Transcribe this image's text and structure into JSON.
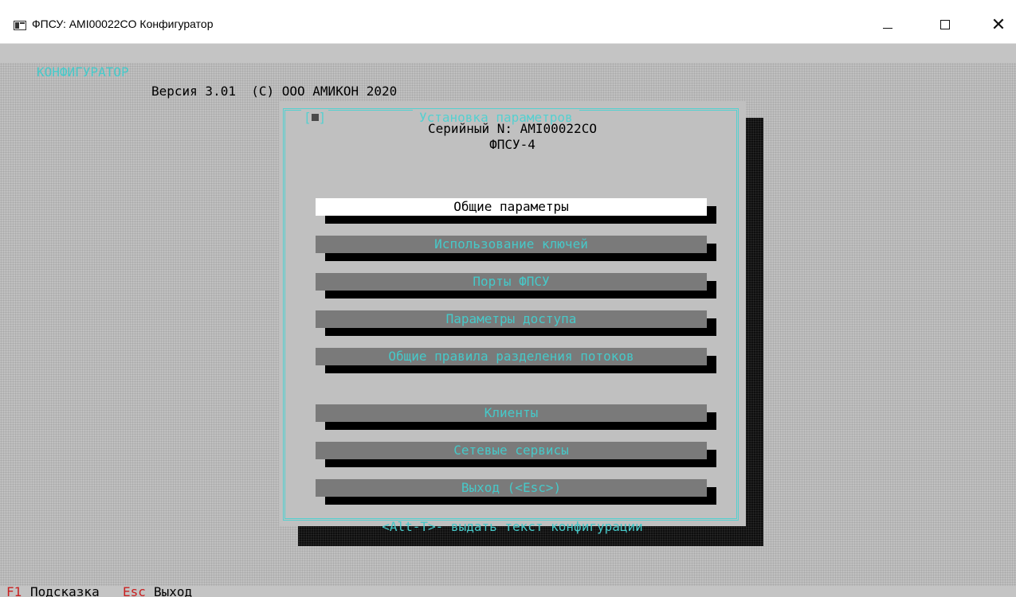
{
  "window": {
    "title": "ФПСУ: AMI00022CO Конфигуратор",
    "minimize_label": "—",
    "maximize_label": "",
    "close_label": "✕"
  },
  "header": {
    "brand": "КОНФИГУРАТОР",
    "version": "Версия 3.01  (C) ООО АМИКОН 2020"
  },
  "dialog": {
    "close_box": "[",
    "close_box_end": "]",
    "title": "Установка параметров",
    "serial": "Серийный N: AMI00022CO",
    "model": "ФПСУ-4",
    "menu": [
      {
        "label": "Общие параметры",
        "selected": true
      },
      {
        "label": "Использование ключей",
        "selected": false
      },
      {
        "label": "Порты ФПСУ",
        "selected": false
      },
      {
        "label": "Параметры доступа",
        "selected": false
      },
      {
        "label": "Общие правила разделения потоков",
        "selected": false
      },
      {
        "label": "Клиенты",
        "selected": false
      },
      {
        "label": "Сетевые сервисы",
        "selected": false
      },
      {
        "label": "Выход (<Esc>)",
        "selected": false
      }
    ],
    "hint": "<Alt-T>- выдать текст конфигурации"
  },
  "statusbar": {
    "f1_key": "F1",
    "f1_label": "Подсказка",
    "esc_key": "Esc",
    "esc_label": "Выход"
  },
  "colors": {
    "accent_cyan": "#46c9c9",
    "frame_cyan": "#55d0d0",
    "button_gray": "#7a7a7a",
    "selected_bg": "#ffffff",
    "key_red": "#c81e1e"
  }
}
